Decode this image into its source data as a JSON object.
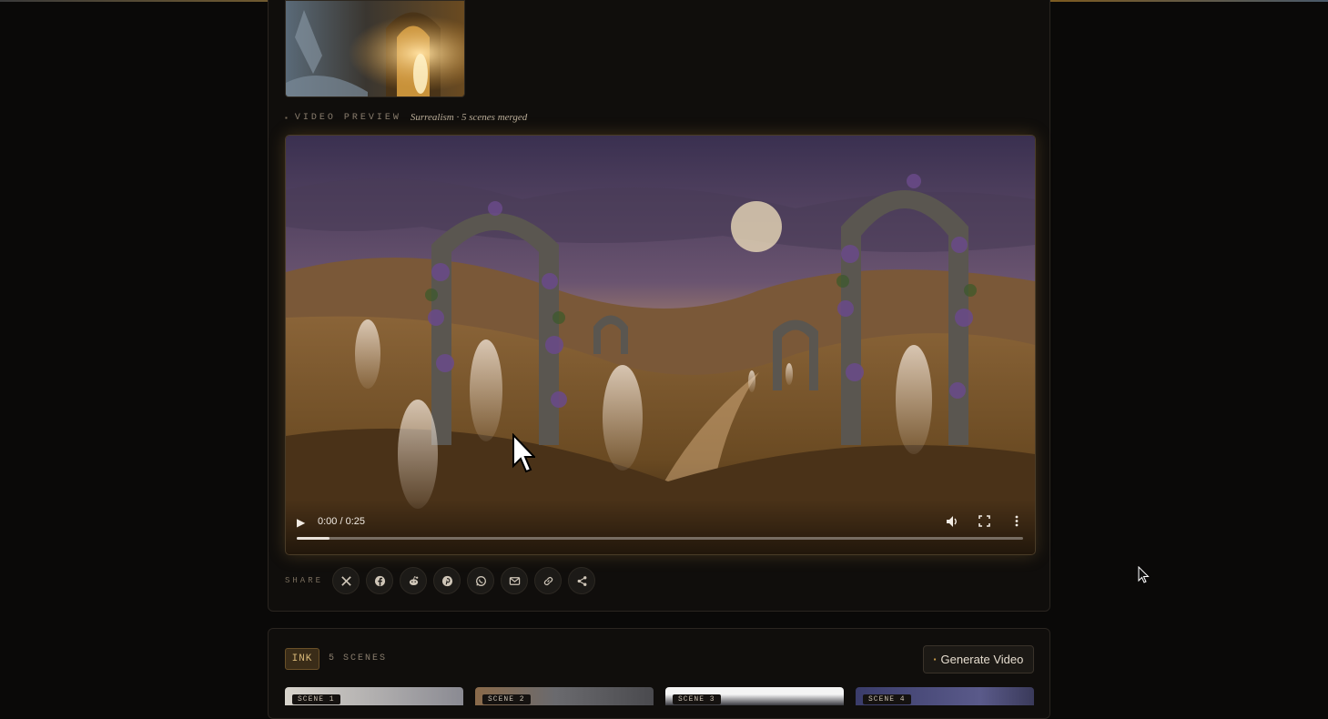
{
  "preview": {
    "section_label": "VIDEO PREVIEW",
    "meta": "Surrealism · 5 scenes merged"
  },
  "video": {
    "time": "0:00 / 0:25",
    "progress": 0.045,
    "icons": [
      "play-icon",
      "volume-icon",
      "fullscreen-icon",
      "more-icon"
    ]
  },
  "share": {
    "label": "SHARE",
    "buttons": [
      "x-icon",
      "facebook-icon",
      "reddit-icon",
      "pinterest-icon",
      "whatsapp-icon",
      "email-icon",
      "link-icon",
      "share-icon"
    ]
  },
  "scenes_panel": {
    "badge": "INK",
    "count": "5 SCENES",
    "generate_label": "Generate Video",
    "scene_tags": [
      "SCENE 1",
      "SCENE 2",
      "SCENE 3",
      "SCENE 4"
    ]
  },
  "colors": {
    "accent": "#c8922e",
    "background": "#0a0908",
    "card": "#100e0c"
  }
}
